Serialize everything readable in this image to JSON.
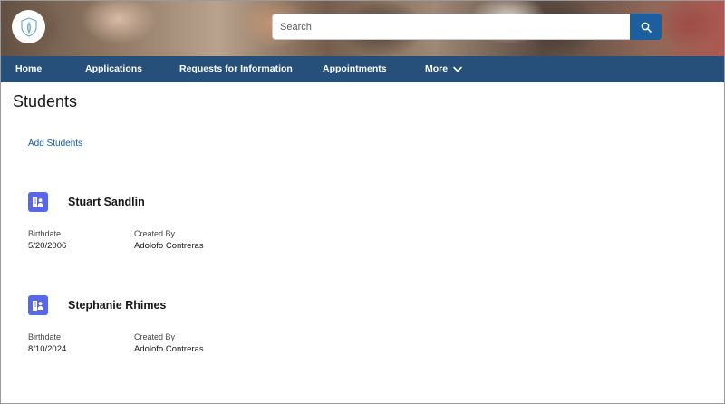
{
  "header": {
    "search": {
      "placeholder": "Search",
      "value": ""
    }
  },
  "nav": {
    "items": [
      {
        "label": "Home"
      },
      {
        "label": "Applications"
      },
      {
        "label": "Requests for Information"
      },
      {
        "label": "Appointments"
      },
      {
        "label": "More"
      }
    ]
  },
  "page": {
    "title": "Students",
    "add_link": "Add Students"
  },
  "records": [
    {
      "name": "Stuart Sandlin",
      "birthdate_label": "Birthdate",
      "birthdate": "5/20/2006",
      "created_by_label": "Created By",
      "created_by": "Adolofo Contreras"
    },
    {
      "name": "Stephanie Rhimes",
      "birthdate_label": "Birthdate",
      "birthdate": "8/10/2024",
      "created_by_label": "Created By",
      "created_by": "Adolofo Contreras"
    }
  ],
  "colors": {
    "nav_bg": "#26507a",
    "search_button": "#1b5f9e",
    "link": "#0b5cab",
    "record_icon": "#5867e8"
  },
  "icons": {
    "logo": "shield-leaf-icon",
    "search": "search-icon",
    "more": "chevron-down-icon",
    "record": "contact-card-icon"
  }
}
